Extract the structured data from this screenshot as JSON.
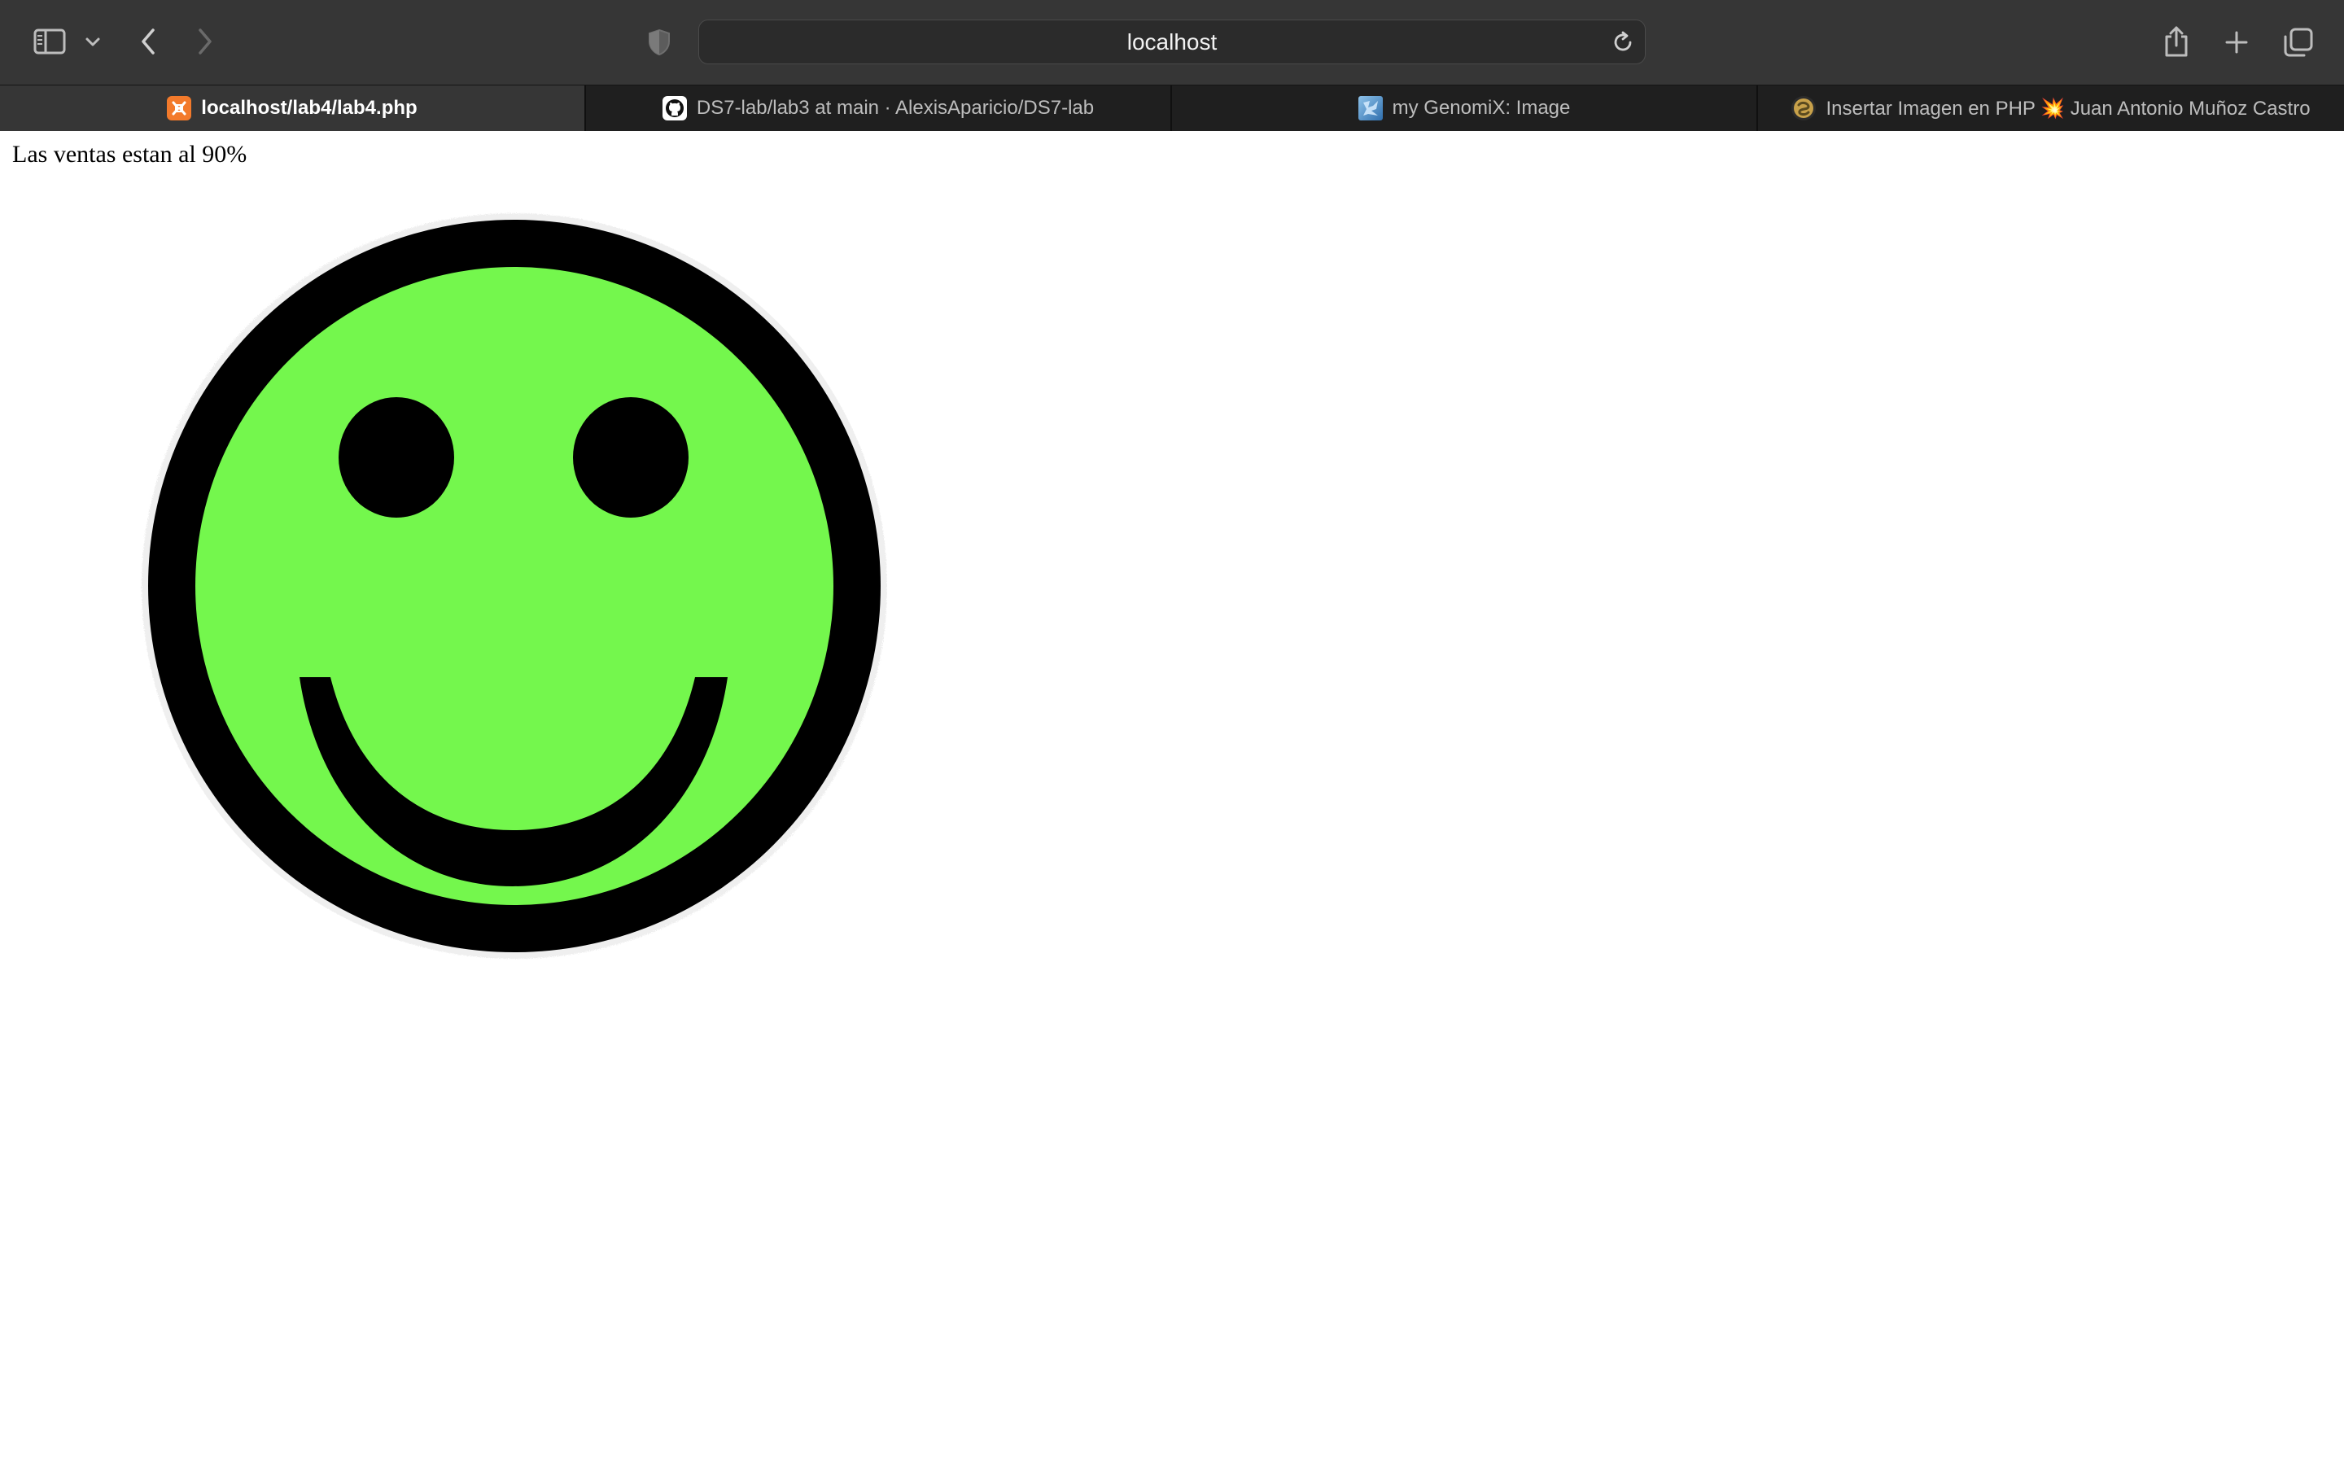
{
  "browser": {
    "url_text": "localhost",
    "toolbar_icons": [
      "sidebar-icon",
      "chevron-down-icon",
      "back-icon",
      "forward-icon",
      "privacy-shield-icon",
      "reload-icon",
      "share-icon",
      "new-tab-icon",
      "tab-overview-icon"
    ],
    "tabs": [
      {
        "label": "localhost/lab4/lab4.php",
        "icon": "xampp-favicon",
        "active": true
      },
      {
        "label": "DS7-lab/lab3 at main · AlexisAparicio/DS7-lab",
        "icon": "github-favicon",
        "active": false
      },
      {
        "label": "my GenomiX: Image",
        "icon": "genomix-favicon",
        "active": false
      },
      {
        "label": "Insertar Imagen en PHP 💥 Juan Antonio Muñoz Castro",
        "icon": "site-favicon",
        "active": false
      }
    ]
  },
  "page": {
    "sales_message": "Las ventas estan al 90%",
    "image": {
      "description_icon": "green-smiley-face-icon",
      "face_color": "#74f74d",
      "outline_color": "#000000"
    }
  },
  "colors": {
    "toolbar_bg": "#363636",
    "tabbar_bg": "#1f1f1f",
    "active_tab_bg": "#363636",
    "page_bg": "#ffffff"
  }
}
